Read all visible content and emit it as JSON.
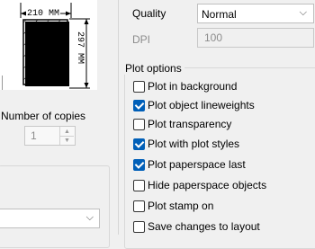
{
  "preview": {
    "width_label": "210 MM",
    "height_label": "297 MM"
  },
  "copies": {
    "label": "Number of copies",
    "value": "1"
  },
  "quality": {
    "label": "Quality",
    "value": "Normal"
  },
  "dpi": {
    "label": "DPI",
    "value": "100"
  },
  "plot_options": {
    "title": "Plot options",
    "items": [
      {
        "label": "Plot in background",
        "checked": false
      },
      {
        "label": "Plot object lineweights",
        "checked": true
      },
      {
        "label": "Plot transparency",
        "checked": false
      },
      {
        "label": "Plot with plot styles",
        "checked": true
      },
      {
        "label": "Plot paperspace last",
        "checked": true
      },
      {
        "label": "Hide paperspace objects",
        "checked": false
      },
      {
        "label": "Plot stamp on",
        "checked": false
      },
      {
        "label": "Save changes to layout",
        "checked": false
      }
    ]
  },
  "colors": {
    "accent": "#005fb8"
  }
}
